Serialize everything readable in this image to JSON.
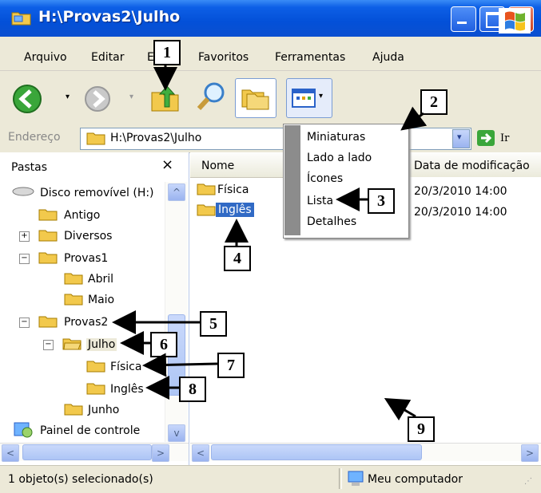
{
  "window": {
    "title": "H:\\Provas2\\Julho"
  },
  "menubar": {
    "items": [
      "Arquivo",
      "Editar",
      "E",
      "Favoritos",
      "Ferramentas",
      "Ajuda"
    ]
  },
  "address": {
    "label": "Endereço",
    "value": "H:\\Provas2\\Julho",
    "go_label": "Ir"
  },
  "folders": {
    "title": "Pastas",
    "close": "×",
    "tree": [
      {
        "label": "Disco removível (H:)",
        "icon": "removable-disk-icon"
      },
      {
        "label": "Antigo"
      },
      {
        "label": "Diversos",
        "expander": "+"
      },
      {
        "label": "Provas1",
        "expander": "−"
      },
      {
        "label": "Abril"
      },
      {
        "label": "Maio"
      },
      {
        "label": "Provas2",
        "expander": "−"
      },
      {
        "label": "Julho",
        "expander": "−"
      },
      {
        "label": "Física"
      },
      {
        "label": "Inglês"
      },
      {
        "label": "Junho"
      },
      {
        "label": "Painel de controle",
        "icon": "control-panel-icon"
      }
    ]
  },
  "content": {
    "columns": [
      "Nome",
      "Data de modificação"
    ],
    "rows": [
      {
        "name": "Física",
        "date": "20/3/2010 14:00"
      },
      {
        "name": "Inglês",
        "date": "20/3/2010 14:00",
        "selected": true
      }
    ]
  },
  "view_menu": {
    "items": [
      "Miniaturas",
      "Lado a lado",
      "Ícones",
      "Lista",
      "Detalhes"
    ]
  },
  "status": {
    "left": "1 objeto(s) selecionado(s)",
    "right": "Meu computador"
  },
  "callouts": [
    "1",
    "2",
    "3",
    "4",
    "5",
    "6",
    "7",
    "8",
    "9"
  ],
  "colors": {
    "titlebar": "#0350d8",
    "selection": "#316ac5",
    "folder": "#f2c94c"
  }
}
